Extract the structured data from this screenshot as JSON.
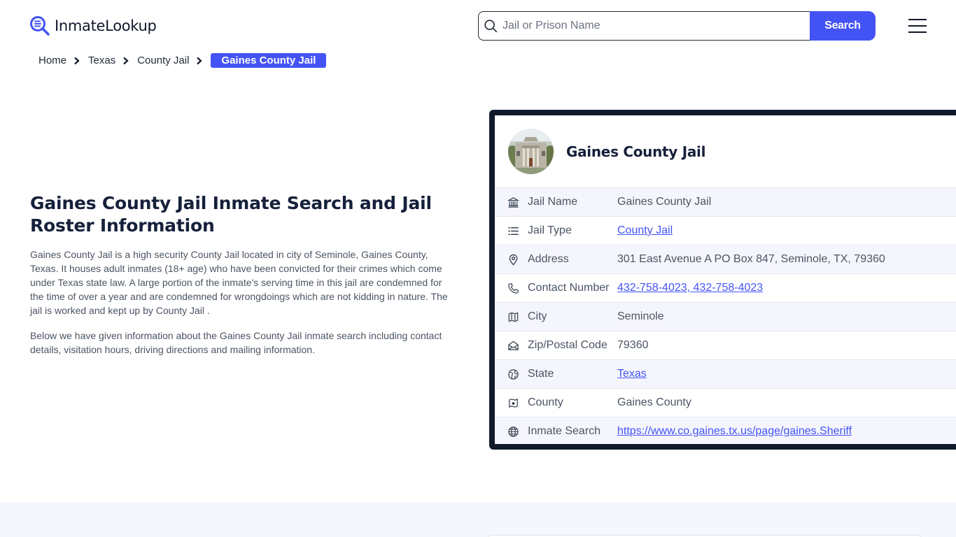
{
  "header": {
    "logo_text": "InmateLookup",
    "search": {
      "placeholder": "Jail or Prison Name",
      "value": "",
      "button_label": "Search"
    },
    "menu_icon": "hamburger-menu-icon"
  },
  "breadcrumb": {
    "items": [
      {
        "label": "Home"
      },
      {
        "label": "Texas"
      },
      {
        "label": "County Jail"
      }
    ],
    "current": "Gaines County Jail"
  },
  "main": {
    "title": "Gaines County Jail Inmate Search and Jail Roster Information",
    "paragraphs": [
      "Gaines County Jail is a high security County Jail located in city of Seminole, Gaines County, Texas. It houses adult inmates (18+ age) who have been convicted for their crimes which come under Texas state law. A large portion of the inmate's serving time in this jail are condemned for the time of over a year and are condemned for wrongdoings which are not kidding in nature. The jail is worked and kept up by County Jail .",
      "Below we have given information about the Gaines County Jail inmate search including contact details, visitation hours, driving directions and mailing information."
    ]
  },
  "info_card": {
    "title": "Gaines County Jail",
    "rows": [
      {
        "icon": "building-columns-icon",
        "label": "Jail Name",
        "value": "Gaines County Jail",
        "link": false
      },
      {
        "icon": "list-icon",
        "label": "Jail Type",
        "value": "County Jail",
        "link": true
      },
      {
        "icon": "map-pin-icon",
        "label": "Address",
        "value": "301 East Avenue A PO Box 847, Seminole, TX, 79360",
        "link": false
      },
      {
        "icon": "phone-icon",
        "label": "Contact Number",
        "value": "432-758-4023, 432-758-4023",
        "link": true
      },
      {
        "icon": "map-icon",
        "label": "City",
        "value": "Seminole",
        "link": false
      },
      {
        "icon": "envelope-open-icon",
        "label": "Zip/Postal Code",
        "value": "79360",
        "link": false
      },
      {
        "icon": "globe-region-icon",
        "label": "State",
        "value": "Texas",
        "link": true
      },
      {
        "icon": "map-marker-square-icon",
        "label": "County",
        "value": "Gaines County",
        "link": false
      },
      {
        "icon": "globe-icon",
        "label": "Inmate Search",
        "value": "https://www.co.gaines.tx.us/page/gaines.Sheriff",
        "link": true
      }
    ]
  },
  "colors": {
    "accent": "#4353f5",
    "card_border": "#101a2c",
    "heading": "#15203a",
    "row_alt": "#f5f6fd",
    "bottom_band": "#f6f6fe"
  }
}
